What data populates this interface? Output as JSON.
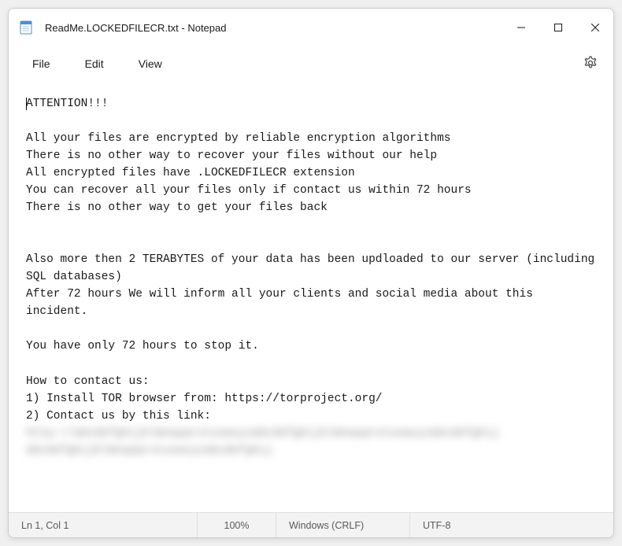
{
  "titlebar": {
    "title": "ReadMe.LOCKEDFILECR.txt - Notepad"
  },
  "menubar": {
    "file": "File",
    "edit": "Edit",
    "view": "View"
  },
  "content": {
    "line1": "ATTENTION!!!",
    "line2": "",
    "line3": "All your files are encrypted by reliable encryption algorithms",
    "line4": "There is no other way to recover your files without our help",
    "line5": "All encrypted files have .LOCKEDFILECR extension",
    "line6": "You can recover all your files only if contact us within 72 hours",
    "line7": "There is no other way to get your files back",
    "line8": "",
    "line9": "",
    "line10": "Also more then 2 TERABYTES of your data has been updloaded to our server (including SQL databases)",
    "line11": "After 72 hours We will inform all your clients and social media about this incident.",
    "line12": "",
    "line13": "You have only 72 hours to stop it.",
    "line14": "",
    "line15": "How to contact us:",
    "line16": "1) Install TOR browser from: https://torproject.org/",
    "line17": "2) Contact us by this link:",
    "blurred1": "http://abcdefghijklmnopqrstuvwxyzabcdefghijklmnopqrstuvwxyzabcdefghij",
    "blurred2": "abcdefghijklmnopqrstuvwxyzabcdefghij"
  },
  "statusbar": {
    "position": "Ln 1, Col 1",
    "zoom": "100%",
    "eol": "Windows (CRLF)",
    "encoding": "UTF-8"
  }
}
